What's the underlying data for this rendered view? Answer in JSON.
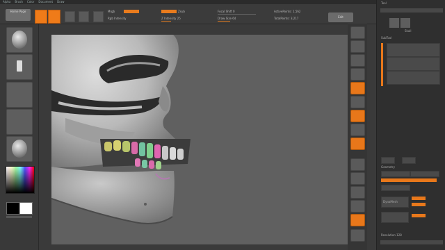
{
  "menubar": {
    "items": [
      "Alpha",
      "Brush",
      "Color",
      "Document",
      "Draw"
    ]
  },
  "topshelf": {
    "home_label": "Home Page",
    "edit_label": "Edit",
    "mrgb_label": "Mrgb",
    "rgb_label": "Rgb",
    "m_label": "M",
    "zadd_label": "Zadd",
    "zsub_label": "Zsub",
    "focal_shift_label": "Focal Shift 0",
    "draw_size_label": "Draw Size 64",
    "rgb_intensity_label": "Rgb Intensity",
    "z_intensity_label": "Z Intensity 25",
    "active_points_label": "ActivePoints: 1,562",
    "total_points_label": "TotalPoints: 3,217"
  },
  "leftshelf": {
    "colors": {
      "main": "#000000",
      "secondary": "#ffffff"
    }
  },
  "canvas": {
    "subject": "skull-3d-model"
  },
  "rightbar": {
    "buttons": [
      "bpr-icon",
      "spix-icon",
      "scroll-icon",
      "zoom-icon",
      "actual-icon",
      "aahalf-icon",
      "persp-icon",
      "floor-icon",
      "local-icon",
      "lsym-icon",
      "xyz-icon",
      "frame-icon",
      "move-icon",
      "scale-icon",
      "rotate-icon",
      "polyf-icon"
    ]
  },
  "sidepanel": {
    "header": "Tool",
    "subtool_label": "SubTool",
    "geometry_label": "Geometry",
    "dynamesh_label": "DynaMesh",
    "resolution_label": "Resolution 128",
    "thumb_label": "Skull"
  },
  "palette": {
    "accent": "#ef7b19",
    "background": "#3a3a3a",
    "panel": "#2f2f2f"
  }
}
